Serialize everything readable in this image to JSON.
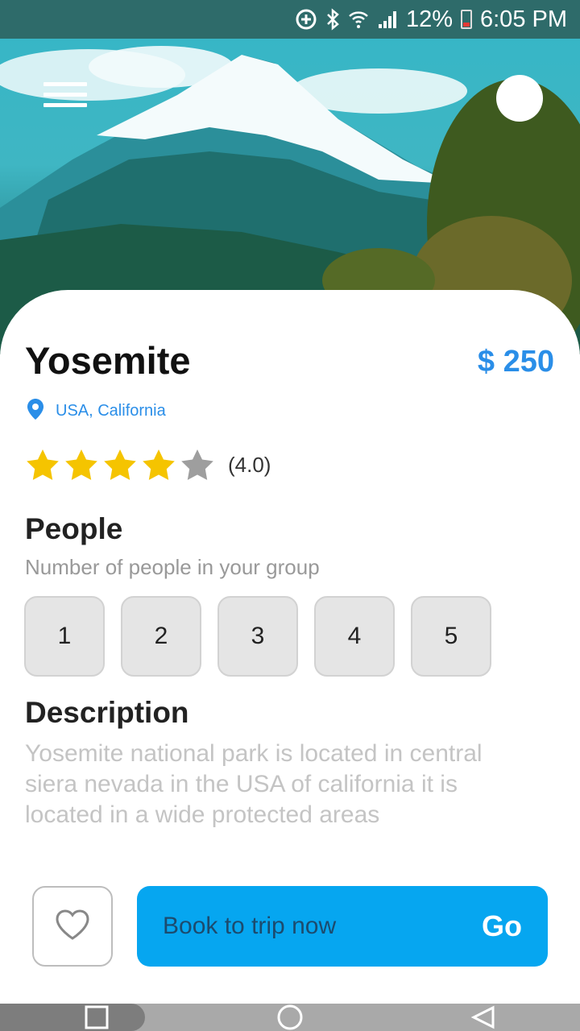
{
  "status_bar": {
    "battery_percent": "12%",
    "time": "6:05 PM",
    "icons": [
      "data-saver-icon",
      "bluetooth-icon",
      "wifi-icon",
      "signal-icon",
      "battery-icon"
    ]
  },
  "header": {
    "menu_icon": "hamburger-icon",
    "avatar": "avatar"
  },
  "place": {
    "name": "Yosemite",
    "price": "$ 250",
    "location": "USA, California",
    "rating": 4,
    "rating_max": 5,
    "rating_text": "(4.0)"
  },
  "people": {
    "title": "People",
    "subtitle": "Number of people in your group",
    "options": [
      "1",
      "2",
      "3",
      "4",
      "5"
    ]
  },
  "description": {
    "title": "Description",
    "text": "Yosemite national park is located in central siera nevada in the USA of california it is located in a wide protected areas"
  },
  "actions": {
    "favorite_icon": "heart-icon",
    "book_label": "Book to trip now",
    "go_label": "Go"
  },
  "nav": {
    "items": [
      "recents-icon",
      "home-icon",
      "back-icon"
    ]
  },
  "colors": {
    "accent": "#2a8ee8",
    "book_button": "#06a6f0",
    "star_filled": "#f5c400",
    "star_empty": "#9e9e9e"
  }
}
